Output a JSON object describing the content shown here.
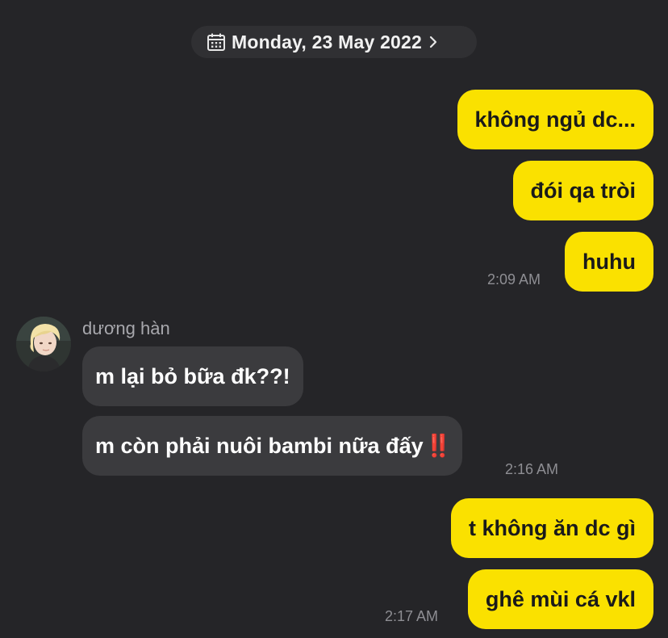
{
  "date_header": {
    "label": "Monday, 23 May 2022",
    "icon": "calendar-icon",
    "chevron": "chevron-right-icon"
  },
  "colors": {
    "background": "#252528",
    "my_bubble": "#fae100",
    "their_bubble": "#3b3b3e",
    "timestamp": "#8e8e93",
    "alert": "#e8231f"
  },
  "messages_group_1": {
    "msg1": "không ngủ dc...",
    "msg2": "đói qa tròi",
    "msg3": "huhu",
    "time": "2:09 AM"
  },
  "messages_group_2": {
    "sender": "dương hàn",
    "msg1": "m lại bỏ bữa đk??!",
    "msg2": "m còn phải nuôi bambi nữa đấy",
    "msg2_emoji": "‼️",
    "time": "2:16 AM"
  },
  "messages_group_3": {
    "msg1": "t không ăn dc gì",
    "msg2": "ghê mùi cá vkl",
    "time": "2:17 AM"
  }
}
